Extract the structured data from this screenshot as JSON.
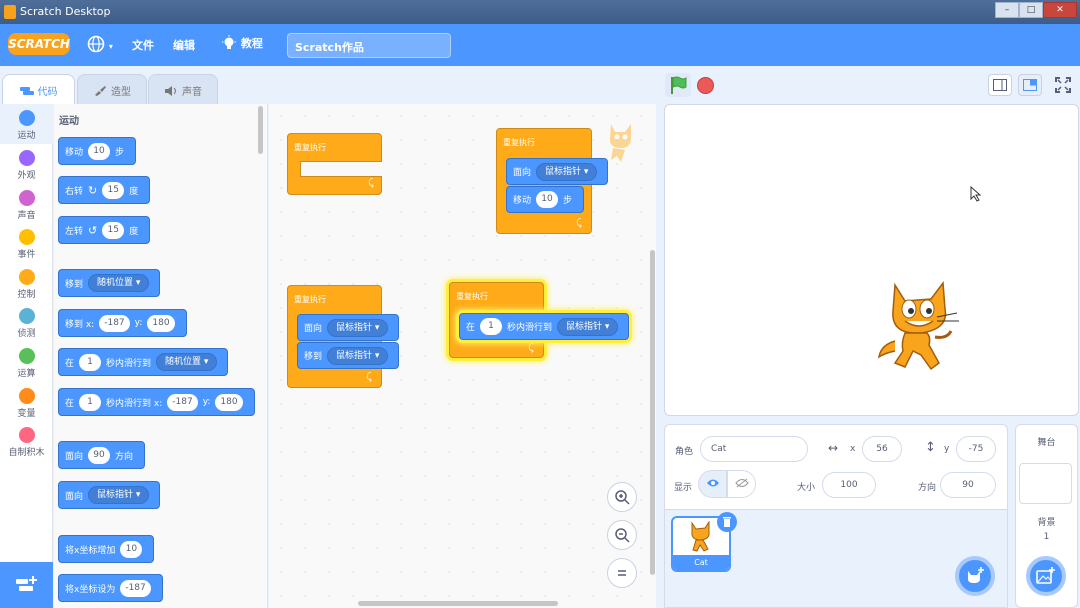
{
  "window": {
    "title": "Scratch Desktop"
  },
  "menubar": {
    "logo": "SCRATCH",
    "language_icon": "globe-icon",
    "file": "文件",
    "edit": "编辑",
    "tutorials": "教程",
    "project_title": "Scratch作品"
  },
  "tabs": [
    {
      "label": "代码",
      "icon": "code-icon",
      "active": true
    },
    {
      "label": "造型",
      "icon": "brush-icon",
      "active": false
    },
    {
      "label": "声音",
      "icon": "speaker-icon",
      "active": false
    }
  ],
  "categories": [
    {
      "label": "运动",
      "color": "#4c97ff"
    },
    {
      "label": "外观",
      "color": "#9966ff"
    },
    {
      "label": "声音",
      "color": "#cf63cf"
    },
    {
      "label": "事件",
      "color": "#ffbf00"
    },
    {
      "label": "控制",
      "color": "#ffab19"
    },
    {
      "label": "侦测",
      "color": "#5cb1d6"
    },
    {
      "label": "运算",
      "color": "#59c059"
    },
    {
      "label": "变量",
      "color": "#ff8c1a"
    },
    {
      "label": "自制积木",
      "color": "#ff6680"
    }
  ],
  "palette": {
    "title": "运动",
    "move": {
      "a": "移动",
      "n": "10",
      "b": "步"
    },
    "turn_right": {
      "a": "右转",
      "n": "15",
      "b": "度"
    },
    "turn_left": {
      "a": "左转",
      "n": "15",
      "b": "度"
    },
    "goto": {
      "a": "移到",
      "d": "随机位置"
    },
    "goto_xy": {
      "a": "移到 x:",
      "x": "-187",
      "b": "y:",
      "y": "180"
    },
    "glide": {
      "a": "在",
      "n": "1",
      "b": "秒内滑行到",
      "d": "随机位置"
    },
    "glide_xy": {
      "a": "在",
      "n": "1",
      "b": "秒内滑行到 x:",
      "x": "-187",
      "c": "y:",
      "y": "180"
    },
    "point_dir": {
      "a": "面向",
      "n": "90",
      "b": "方向"
    },
    "point_towards": {
      "a": "面向",
      "d": "鼠标指针"
    },
    "change_x": {
      "a": "将x坐标增加",
      "n": "10"
    },
    "set_x": {
      "a": "将x坐标设为",
      "n": "-187"
    }
  },
  "scripts": {
    "repeat": "重复执行",
    "point": "面向",
    "mouse": "鼠标指针",
    "move": "移动",
    "move_n": "10",
    "move_b": "步",
    "goto": "移到",
    "glide_a": "在",
    "glide_n": "1",
    "glide_b": "秒内滑行到"
  },
  "sprite_info": {
    "sprite_label": "角色",
    "name": "Cat",
    "x_label": "x",
    "x": "56",
    "y_label": "y",
    "y": "-75",
    "show_label": "显示",
    "size_label": "大小",
    "size": "100",
    "direction_label": "方向",
    "direction": "90"
  },
  "sprite_list": [
    {
      "name": "Cat",
      "selected": true
    }
  ],
  "stage_pane": {
    "title": "舞台",
    "backdrop_label": "背景",
    "backdrop_count": "1"
  },
  "icons": {
    "green_flag": "green-flag-icon",
    "stop": "stop-icon",
    "zoom_in": "zoom-in-icon",
    "zoom_out": "zoom-out-icon",
    "zoom_reset": "zoom-reset-icon"
  },
  "colors": {
    "motion": "#4c97ff",
    "control": "#ffab19",
    "menubar": "#4c97ff"
  }
}
